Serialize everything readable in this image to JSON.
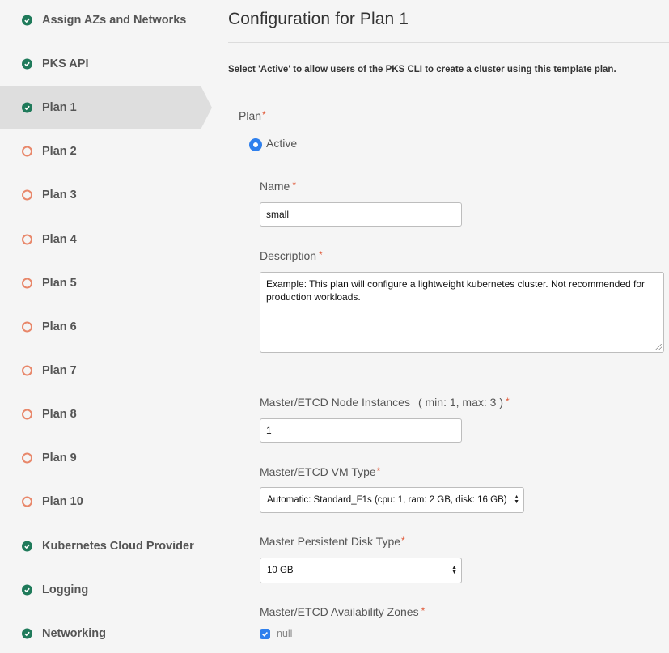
{
  "sidebar": {
    "items": [
      {
        "label": "Assign AZs and Networks",
        "status": "complete"
      },
      {
        "label": "PKS API",
        "status": "complete"
      },
      {
        "label": "Plan 1",
        "status": "complete",
        "active": true
      },
      {
        "label": "Plan 2",
        "status": "incomplete"
      },
      {
        "label": "Plan 3",
        "status": "incomplete"
      },
      {
        "label": "Plan 4",
        "status": "incomplete"
      },
      {
        "label": "Plan 5",
        "status": "incomplete"
      },
      {
        "label": "Plan 6",
        "status": "incomplete"
      },
      {
        "label": "Plan 7",
        "status": "incomplete"
      },
      {
        "label": "Plan 8",
        "status": "incomplete"
      },
      {
        "label": "Plan 9",
        "status": "incomplete"
      },
      {
        "label": "Plan 10",
        "status": "incomplete"
      },
      {
        "label": "Kubernetes Cloud Provider",
        "status": "complete"
      },
      {
        "label": "Logging",
        "status": "complete"
      },
      {
        "label": "Networking",
        "status": "complete"
      }
    ]
  },
  "main": {
    "title": "Configuration for Plan 1",
    "intro": "Select 'Active' to allow users of the PKS CLI to create a cluster using this template plan.",
    "plan": {
      "label": "Plan",
      "required_mark": "*",
      "option_label": "Active"
    },
    "name": {
      "label": "Name",
      "required_mark": "*",
      "value": "small"
    },
    "description": {
      "label": "Description",
      "required_mark": "*",
      "value": "Example: This plan will configure a lightweight kubernetes cluster. Not recommended for production workloads."
    },
    "instances": {
      "label": "Master/ETCD Node Instances",
      "hint": "( min: 1, max: 3 )",
      "required_mark": "*",
      "value": "1"
    },
    "vm_type": {
      "label": "Master/ETCD VM Type",
      "required_mark": "*",
      "value": "Automatic: Standard_F1s (cpu: 1, ram: 2 GB, disk: 16 GB)"
    },
    "disk_type": {
      "label": "Master Persistent Disk Type",
      "required_mark": "*",
      "value": "10 GB"
    },
    "azs": {
      "label": "Master/ETCD Availability Zones",
      "required_mark": "*",
      "option_label": "null"
    }
  },
  "colors": {
    "complete": "#1f7a5a",
    "incomplete": "#e8876a",
    "accent": "#2f80ed",
    "required": "#e05a3a"
  }
}
